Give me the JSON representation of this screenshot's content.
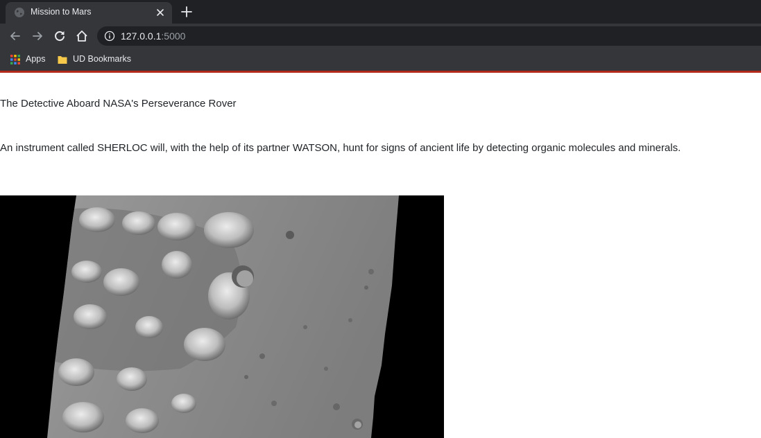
{
  "browser": {
    "tab": {
      "title": "Mission to Mars"
    },
    "address": {
      "host": "127.0.0.1",
      "port": ":5000"
    },
    "bookmarks": [
      {
        "label": "Apps",
        "icon": "apps-grid-icon"
      },
      {
        "label": "UD Bookmarks",
        "icon": "folder-icon"
      }
    ],
    "accent_color": "#b0291a"
  },
  "page": {
    "news_title": "The Detective Aboard NASA's Perseverance Rover",
    "news_paragraph": "An instrument called SHERLOC will, with the help of its partner WATSON, hunt for signs of ancient life by detecting organic molecules and minerals."
  }
}
